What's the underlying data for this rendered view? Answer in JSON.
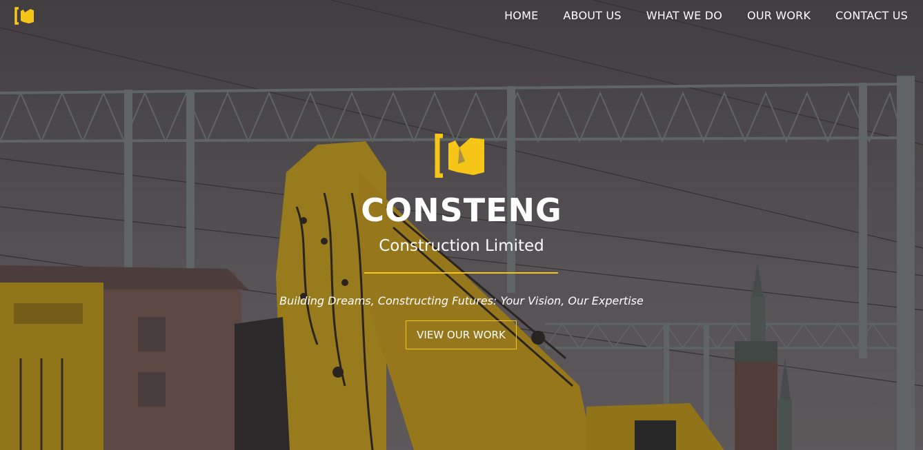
{
  "brand": {
    "name": "CONSTENG",
    "subtitle": "Construction Limited",
    "tagline": "Building Dreams, Constructing Futures: Your Vision, Our Expertise",
    "logo_icon": "c-bracket-logo-icon"
  },
  "nav": {
    "items": [
      {
        "label": "HOME"
      },
      {
        "label": "ABOUT US"
      },
      {
        "label": "WHAT WE DO"
      },
      {
        "label": "OUR WORK"
      },
      {
        "label": "CONTACT US"
      }
    ]
  },
  "hero": {
    "cta_label": "VIEW OUR WORK"
  },
  "colors": {
    "accent": "#f5c518",
    "text": "#ffffff",
    "sky": "#6b6568",
    "steel": "#7a8582"
  }
}
